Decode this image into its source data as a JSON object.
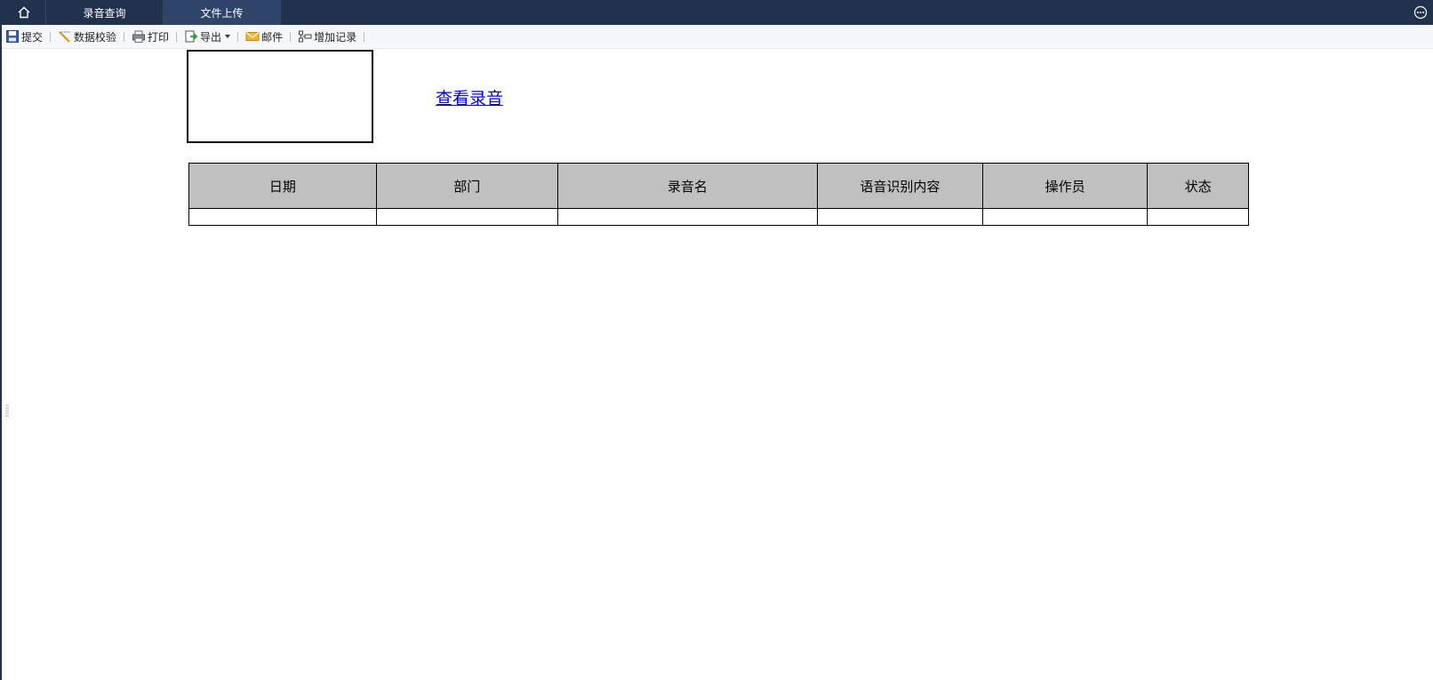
{
  "tabs": [
    {
      "label": "录音查询"
    },
    {
      "label": "文件上传"
    }
  ],
  "toolbar": {
    "submit": "提交",
    "validate": "数据校验",
    "print": "打印",
    "export": "导出",
    "mail": "邮件",
    "add_record": "增加记录"
  },
  "content": {
    "view_link": "查看录音"
  },
  "table": {
    "headers": [
      "日期",
      "部门",
      "录音名",
      "语音识别内容",
      "操作员",
      "状态"
    ],
    "rows": [
      [
        "",
        "",
        "",
        "",
        "",
        ""
      ]
    ]
  },
  "colors": {
    "topbar": "#22324e",
    "active_tab": "#2e4468",
    "header_cell": "#c0c0c0",
    "link": "#0000ee"
  },
  "icons": [
    "home-icon",
    "more-icon",
    "save-icon",
    "validate-icon",
    "print-icon",
    "export-icon",
    "mail-icon",
    "add-record-icon"
  ]
}
